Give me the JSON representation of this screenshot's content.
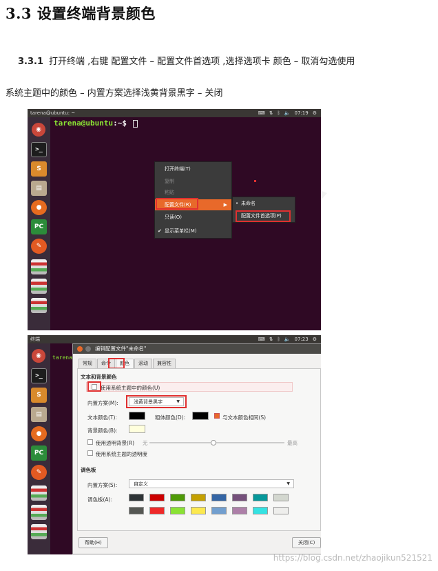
{
  "heading": "3.3  设置终端背景颜色",
  "step": {
    "number": "3.3.1",
    "line1": "打开终端 ,右键  配置文件  –  配置文件首选项 ,选择选项卡  颜色  –  取消勾选使用",
    "line2": "系统主题中的颜色  –  内置方案选择浅黄背景黑字  –  关闭"
  },
  "shot1": {
    "window_title": "tarena@ubuntu: ~",
    "clock": "07:19",
    "prompt_user": "tarena@ubuntu",
    "prompt_rest": ":~$",
    "menu": {
      "open_terminal": "打开终端(T)",
      "copy": "复制",
      "paste": "粘贴",
      "profiles": "配置文件(R)",
      "read_only": "只读(O)",
      "show_menubar": "显示菜单栏(M)"
    },
    "submenu": {
      "unnamed": "未命名",
      "preferences": "配置文件首选项(P)"
    },
    "launcher_icons": [
      "ubuntu-logo-icon",
      "terminal-icon",
      "sublime-icon",
      "files-icon",
      "firefox-icon",
      "pycharm-icon",
      "editor-icon",
      "stack-icon"
    ]
  },
  "shot2": {
    "window_title": "终端",
    "clock": "07:23",
    "terminal_text": "tarena",
    "dialog_title": "编辑配置文件\"未命名\"",
    "tabs": [
      "常规",
      "命令",
      "颜色",
      "滚动",
      "兼容性"
    ],
    "section_text_bg": "文本和背景颜色",
    "use_system_colors": "使用系统主题中的颜色(U)",
    "builtin_scheme_label": "内置方案(M):",
    "builtin_scheme_value": "浅黄背景黑字",
    "text_color_label": "文本颜色(T):",
    "bold_color_label": "粗体颜色(D):",
    "same_as_text": "与文本颜色相同(S)",
    "bg_color_label": "背景颜色(B):",
    "use_transparent_bg": "使用透明背景(R)",
    "none": "无",
    "max": "最高",
    "use_system_transparency": "使用系统主题的透明度",
    "section_palette": "调色板",
    "palette_scheme_label": "内置方案(S):",
    "palette_scheme_value": "自定义",
    "palette_label": "调色板(A):",
    "help_button": "帮助(H)",
    "close_button": "关闭(C)",
    "text_color": "#000000",
    "bold_color": "#000000",
    "bg_color": "#ffffdd",
    "palette_row1": [
      "#2e3436",
      "#cc0000",
      "#4e9a06",
      "#c4a000",
      "#3465a4",
      "#75507b",
      "#06989a",
      "#d3d7cf"
    ],
    "palette_row2": [
      "#555753",
      "#ef2929",
      "#8ae234",
      "#fce94f",
      "#729fcf",
      "#ad7fa8",
      "#34e2e2",
      "#eeeeec"
    ]
  },
  "credit": "https://blog.csdn.net/zhaojikun521521",
  "watermark": "NA"
}
